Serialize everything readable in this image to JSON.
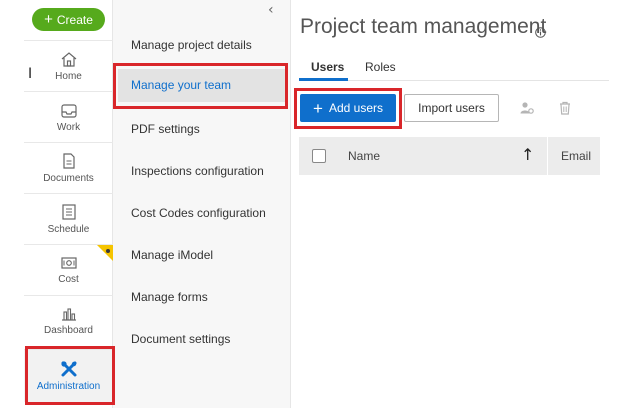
{
  "rail": {
    "create_label": "Create",
    "items": [
      {
        "label": "Home",
        "icon": "home-icon"
      },
      {
        "label": "Work",
        "icon": "work-inbox-icon"
      },
      {
        "label": "Documents",
        "icon": "document-icon"
      },
      {
        "label": "Schedule",
        "icon": "schedule-icon"
      },
      {
        "label": "Cost",
        "icon": "cost-icon"
      },
      {
        "label": "Dashboard",
        "icon": "dashboard-icon"
      },
      {
        "label": "Administration",
        "icon": "tools-icon"
      }
    ],
    "active_item": "Administration"
  },
  "admin_menu": {
    "items": [
      "Manage project details",
      "Manage your team",
      "PDF settings",
      "Inspections configuration",
      "Cost Codes configuration",
      "Manage iModel",
      "Manage forms",
      "Document settings"
    ],
    "active_item": "Manage your team"
  },
  "main": {
    "title": "Project team management",
    "tabs": [
      "Users",
      "Roles"
    ],
    "active_tab": "Users",
    "toolbar": {
      "add_label": "Add users",
      "import_label": "Import users"
    },
    "table": {
      "columns": [
        "Name",
        "Email"
      ],
      "sort_column": "Name",
      "sort_direction": "ascending"
    }
  },
  "colors": {
    "accent": "#0f6fcc",
    "create_green": "#56aa1c",
    "highlight_red": "#d9262a",
    "badge_yellow": "#f5c400"
  }
}
